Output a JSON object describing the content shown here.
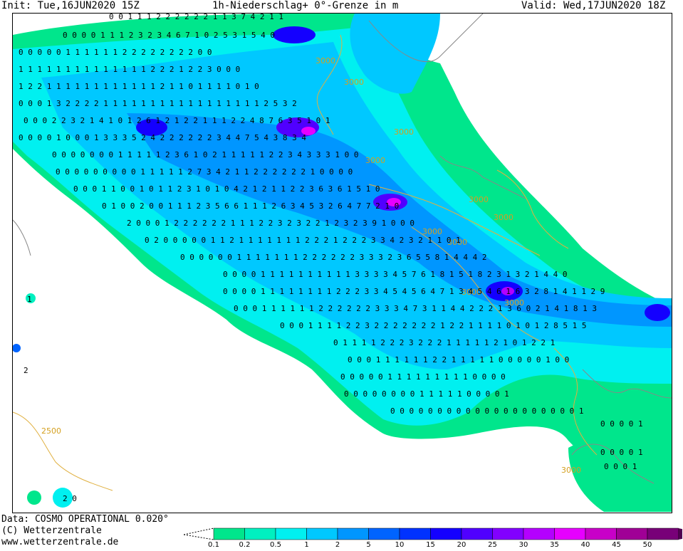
{
  "header": {
    "init": "Init: Tue,16JUN2020 15Z",
    "title": "1h-Niederschlag+ 0°-Grenze in m",
    "valid": "Valid: Wed,17JUN2020 18Z"
  },
  "footer": {
    "data": "Data: COSMO OPERATIONAL 0.020°",
    "copyright": "(C) Wetterzentrale",
    "url": "www.wetterzentrale.de"
  },
  "legend": {
    "labels": [
      "0.1",
      "0.2",
      "0.5",
      "1",
      "2",
      "5",
      "10",
      "15",
      "20",
      "25",
      "30",
      "35",
      "40",
      "45",
      "50"
    ],
    "colors": [
      "#00e68c",
      "#00f0c0",
      "#00f0f0",
      "#00c8ff",
      "#0096ff",
      "#0064ff",
      "#0032ff",
      "#1400ff",
      "#5000ff",
      "#8200ff",
      "#b400ff",
      "#e600ff",
      "#c800c8",
      "#a00096",
      "#780078"
    ]
  },
  "map": {
    "contour_labels": [
      "3000",
      "3000",
      "3000",
      "3000",
      "3000",
      "3000",
      "3000",
      "3000",
      "3000",
      "3000",
      "2500",
      "3000"
    ],
    "value_rows": [
      "0 0 1 1 1 2 2 2 2 2 2 1 1 3 7 4 2 1 1",
      "0 0 0 0 1 1 1 2 3 2 3 4 6 7 1 0 2 5 3 1 5 4 0",
      "0 0 0 0 0 1 1 1 1 1 1 2 2 2 2 2 2 2 2 0 0",
      "1 1 1 1 1 1 1 1 1 1 1 1 1 1 2 2 2 1 2 2 3 0 0 0",
      "1 2 2 1 1 1 1 1 1 1 1 1 1 1 1 2 1 1 0 1 1 1 1 0 1 0",
      "0 0 0 1 3 2 2 2 2 1 1 1 1 1 1 1 1 1 1 1 1 1 1 1 1 1 2 5 3 2",
      "0 0 0 2 2 3 2 1 4 1 0 1 2 6 1 2 1 2 2 1 1 1 2 2 4 8 7 6 3 5 1 0 1",
      "0 0 0 0 1 0 0 0 1 3 3 3 5 2 4 2 2 2 2 2 2 3 4 4 7 5 4 3 8 3 4",
      "0 0 0 0 0 0 0 1 1 1 1 1 2 3 6 1 0 2 1 1 1 1 1 2 2 3 4 3 3 3 1 0 0",
      "0 0 0 0 0 0 0 0 0 1 1 1 1 1 2 7 3 4 2 1 1 2 2 2 2 2 2 1 0 0 0 0",
      "0 0 0 1 1 0 0 1 0 1 1 2 3 1 0 1 0 4 2 1 2 1 1 2 2 3 6 3 6 1 5 1 0",
      "0 1 0 0 2 0 0 1 1 1 2 3 5 6 6 1 1 1 2 6 3 4 5 3 2 6 4 7 7 2 1 0",
      "2 0 0 0 1 2 2 2 2 2 2 1 1 1 2 2 3 2 3 2 2 1 2 3 2 3 9 1 0 0 0",
      "0 2 0 0 0 0 0 1 1 2 1 1 1 1 1 1 1 2 2 2 1 2 2 2 3 3 4 2 3 2 1 1 0 1",
      "0 0 0 0 0 0 1 1 1 1 1 1 1 2 2 2 2 2 2 3 3 3 2 3 6 5 5 8 1 4 4 4 2",
      "0 0 0 0 1 1 1 1 1 1 1 1 1 1 3 3 3 3 4 5 7 6 1 8 1 5 1 8 2 3 1 3 2 1 4 4 0",
      "0 0 0 0 1 1 1 1 1 1 1 1 2 2 2 3 3 4 5 4 5 6 4 7 1 3 4 5 4 6 1 6 3 2 8 1 4 1 1 2 9",
      "0 0 0 1 1 1 1 1 1 2 2 2 2 2 2 3 3 3 4 7 3 1 1 4 4 2 2 2 1 3 6 0 2 1 4 1 8 1 3",
      "0 0 0 1 1 1 1 2 2 3 2 2 2 2 2 2 2 1 2 2 1 1 1 1 0 1 0 1 2 8 5 1 5",
      "0 1 1 1 1 2 2 2 3 2 2 2 1 1 1 1 1 2 1 0 1 2 2 1",
      "0 0 0 1 1 1 1 1 1 2 2 1 1 1 1 1 0 0 0 0 0 1 0 0",
      "0 0 0 0 0 1 1 1 1 1 1 1 1 1 0 0 0 0",
      "0 0 0 0 0 0 0 0 1 1 1 1 1 0 0 0 0 1",
      "0 0 0 0 0 0 0 0 0 0 0 0 0 0 0 0 0 0 0 0 1",
      "0 0 0 0 1",
      "0 0 0 0 1",
      "0 0 0 1",
      "1",
      "2",
      "2 0"
    ]
  }
}
